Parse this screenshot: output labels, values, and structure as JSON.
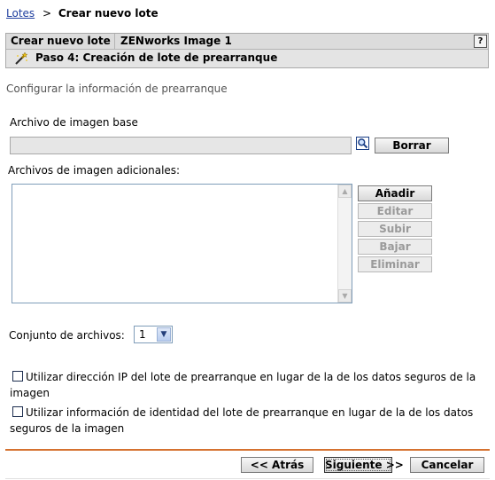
{
  "breadcrumb": {
    "parent": "Lotes",
    "separator": ">",
    "current": "Crear nuevo lote"
  },
  "wizard": {
    "title": "Crear nuevo lote",
    "name": "ZENworks Image 1",
    "help": "?",
    "step": "Paso 4: Creación de lote de prearranque",
    "step_icon": "wand-icon"
  },
  "subtitle": "Configurar la información de prearranque",
  "base_image": {
    "label": "Archivo de imagen base",
    "value": "",
    "browse_icon": "search-icon",
    "clear_label": "Borrar"
  },
  "additional_images": {
    "label": "Archivos de imagen adicionales:",
    "items": [],
    "buttons": {
      "add": "Añadir",
      "edit": "Editar",
      "up": "Subir",
      "down": "Bajar",
      "remove": "Eliminar"
    }
  },
  "file_set": {
    "label": "Conjunto de archivos:",
    "selected": "1"
  },
  "options": {
    "use_ip": {
      "checked": false,
      "label": "Utilizar dirección IP del lote de prearranque en lugar de la de los datos seguros de la imagen"
    },
    "use_identity": {
      "checked": false,
      "label": "Utilizar información de identidad del lote de prearranque en lugar de la de los datos seguros de la imagen"
    }
  },
  "footer": {
    "back": "<< Atrás",
    "next": "Siguiente >>",
    "cancel": "Cancelar"
  },
  "colors": {
    "accent_line": "#d5712f",
    "link": "#1f3f9f"
  }
}
